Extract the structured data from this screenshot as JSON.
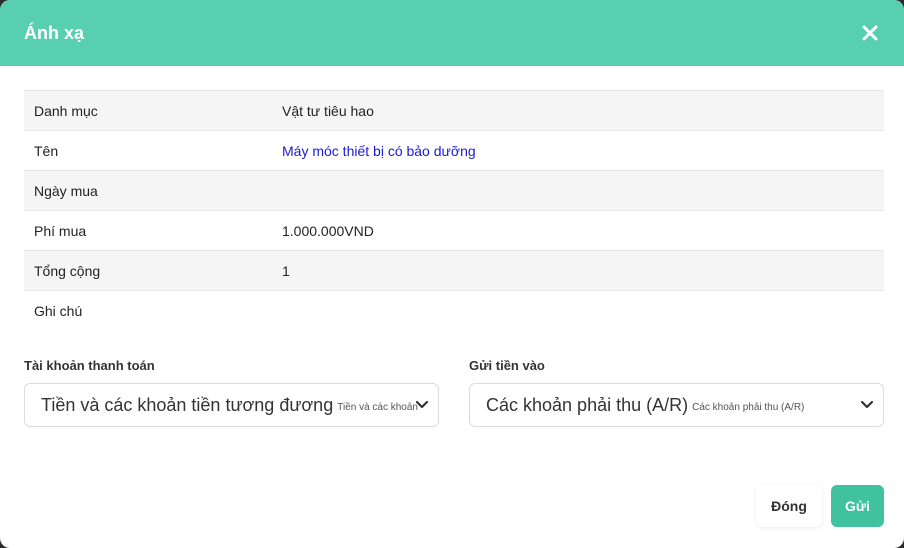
{
  "modal": {
    "title": "Ánh xạ",
    "close_icon": "close-icon",
    "header_color": "#57cfb0"
  },
  "details": [
    {
      "label": "Danh mục",
      "value": ""
    },
    {
      "label": "Tên",
      "value": "Máy móc thiết bị có bảo dưỡng"
    },
    {
      "label": "Ngày mua",
      "value": ""
    },
    {
      "label": "Phí mua",
      "value": "1.000.000VND"
    },
    {
      "label": "Tổng cộng",
      "value": "1"
    },
    {
      "label": "Ghi chú",
      "value": ""
    }
  ],
  "category_value": "Vật tư tiêu hao",
  "payment_account": {
    "label": "Tài khoản thanh toán",
    "selected": "Tiền và các khoản tiền tương đương",
    "selected_sub": "Tiền và các khoản"
  },
  "deposit_to": {
    "label": "Gửi tiền vào",
    "selected": "Các khoản phải thu (A/R)",
    "selected_sub": "Các khoản phải thu (A/R)"
  },
  "buttons": {
    "close_label": "Đóng",
    "submit_label": "Gửi",
    "submit_color": "#3fc29d"
  }
}
